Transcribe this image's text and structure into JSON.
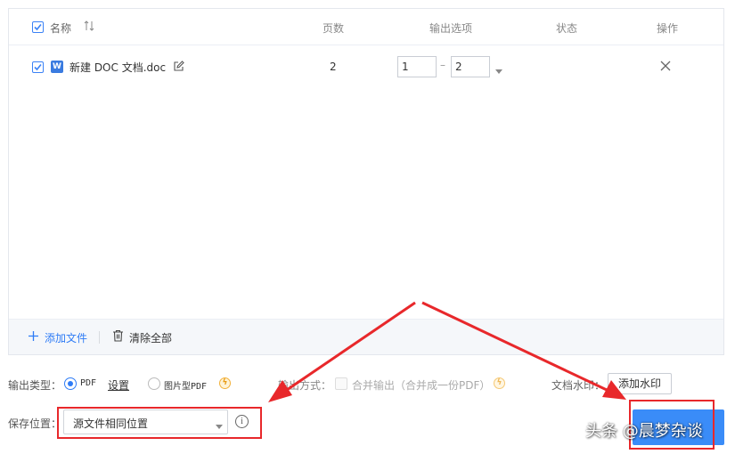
{
  "table": {
    "header": {
      "name_label": "名称",
      "sort_icon": "sort-toggle-icon",
      "pages_label": "页数",
      "output_label": "输出选项",
      "status_label": "状态",
      "action_label": "操作"
    },
    "rows": [
      {
        "checked": true,
        "file_icon": "wps-doc-icon",
        "file_icon_glyph": "W",
        "file_name": "新建 DOC 文档.doc",
        "pages": "2",
        "range_from": "1",
        "range_sep": "–",
        "range_to": "2"
      }
    ],
    "footer": {
      "add_file_label": "添加文件",
      "clear_all_label": "清除全部"
    }
  },
  "options": {
    "output_type_label": "输出类型：",
    "pdf_label": "PDF",
    "settings_link": "设置",
    "image_pdf_label": "图片型PDF",
    "output_mode_label": "输出方式：",
    "merge_label": "合并输出（合并成一份PDF）",
    "doc_watermark_label": "文档水印：",
    "add_watermark_button": "添加水印",
    "save_location_label": "保存位置：",
    "save_location_value": "源文件相同位置",
    "info_glyph": "i"
  },
  "watermark_text": "头条 @晨梦杂谈",
  "colors": {
    "accent": "#2f7cf6",
    "annotation_red": "#e8282b",
    "start_button": "#3a8cf8",
    "vip_badge": "#f2b13a"
  }
}
